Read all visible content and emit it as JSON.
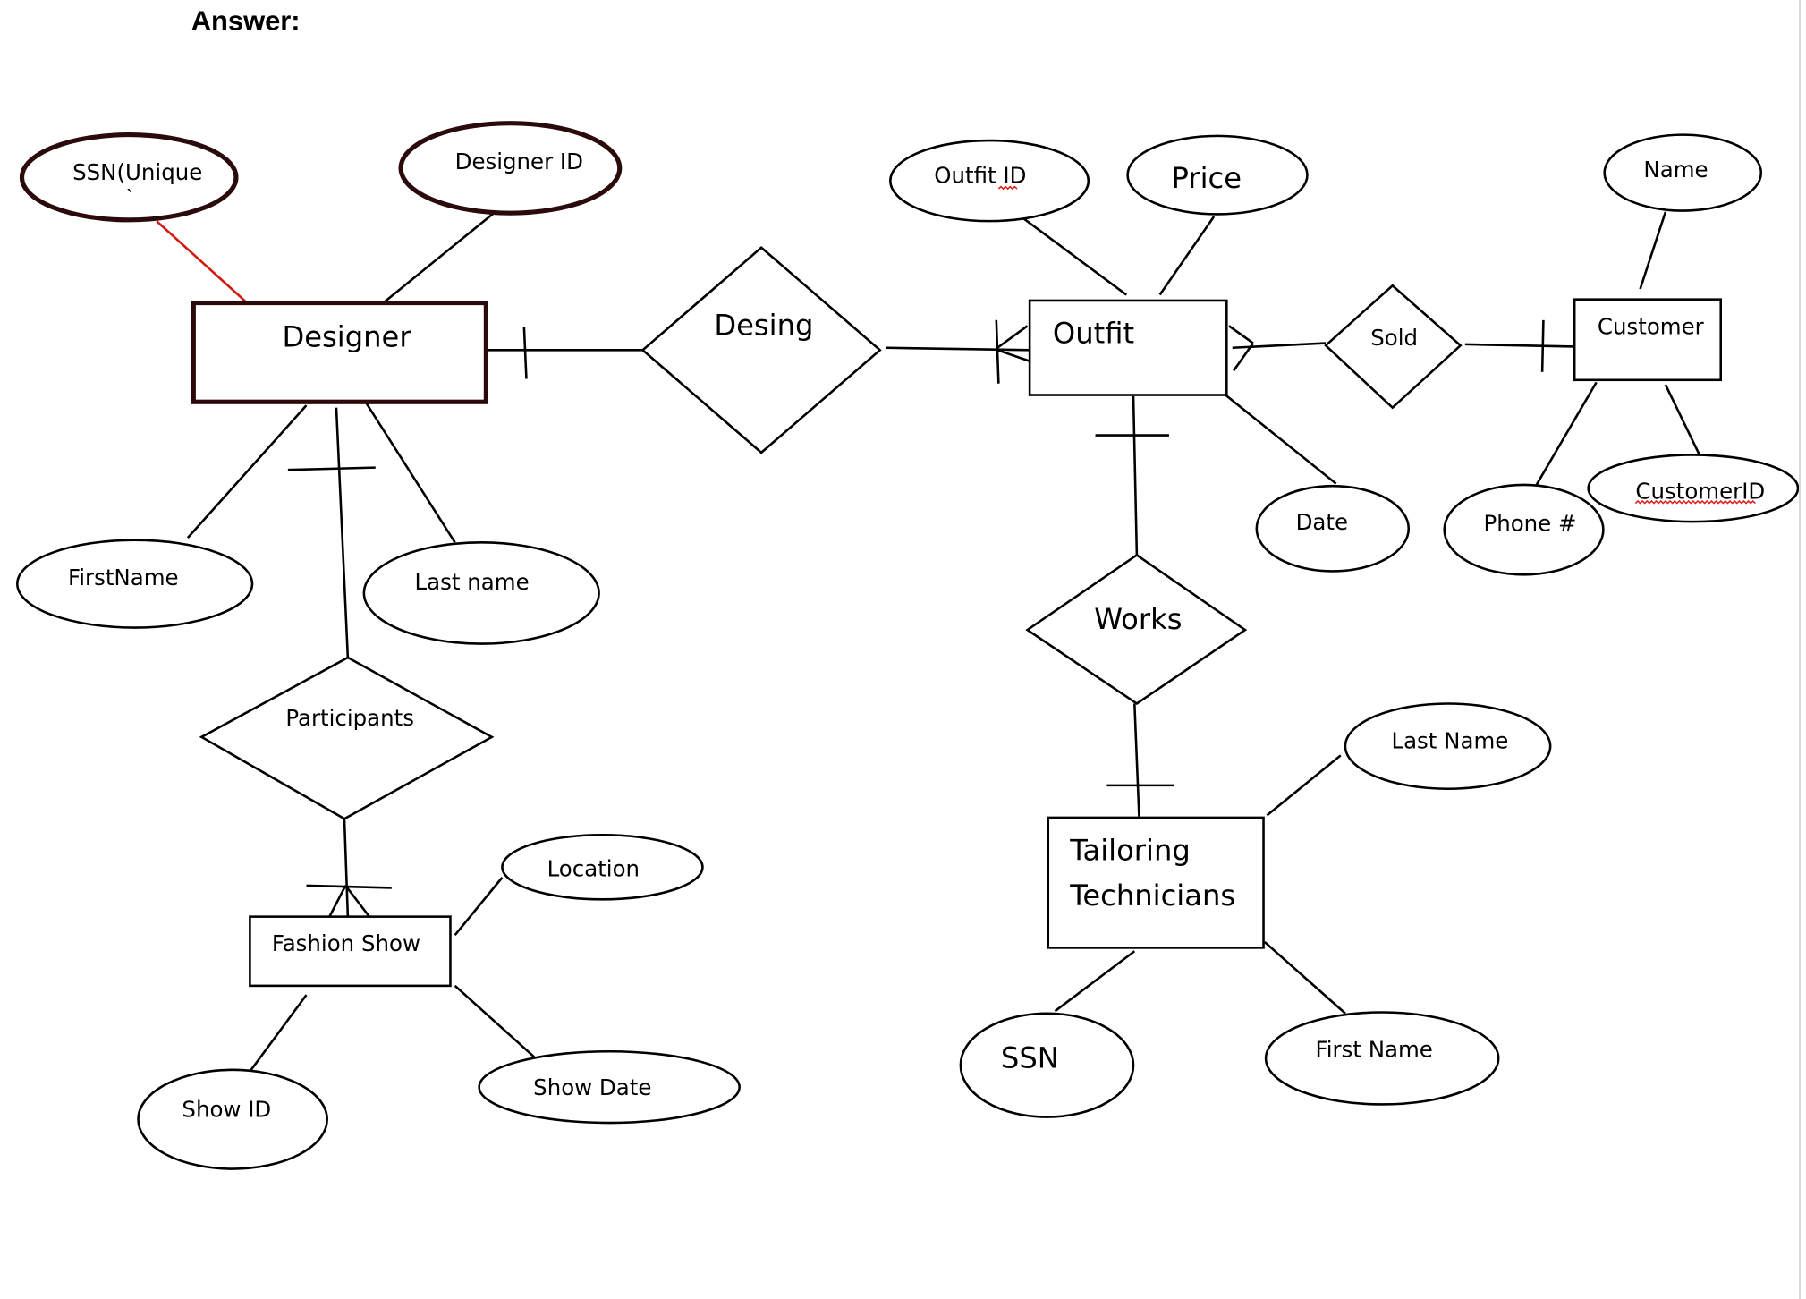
{
  "heading": "Answer:",
  "entities": {
    "designer": "Designer",
    "outfit": "Outfit",
    "customer": "Customer",
    "fashion_show": "Fashion Show",
    "tailoring_line1": "Tailoring",
    "tailoring_line2": "Technicians"
  },
  "relationships": {
    "desing": "Desing",
    "sold": "Sold",
    "works": "Works",
    "participants": "Participants"
  },
  "attributes": {
    "ssn_unique": "SSN(Unique",
    "ssn_unique_mark": "`",
    "designer_id": "Designer ID",
    "first_name_designer": "FirstName",
    "last_name_designer": "Last name",
    "outfit_id": "Outfit ID",
    "price": "Price",
    "date": "Date",
    "name": "Name",
    "phone": "Phone #",
    "customer_id": "CustomerID",
    "location": "Location",
    "show_id": "Show ID",
    "show_date": "Show Date",
    "last_name_tech": "Last Name",
    "first_name_tech": "First Name",
    "ssn_tech": "SSN"
  },
  "colors": {
    "key_link": "#d0190f",
    "spellcheck": "#e02020"
  }
}
